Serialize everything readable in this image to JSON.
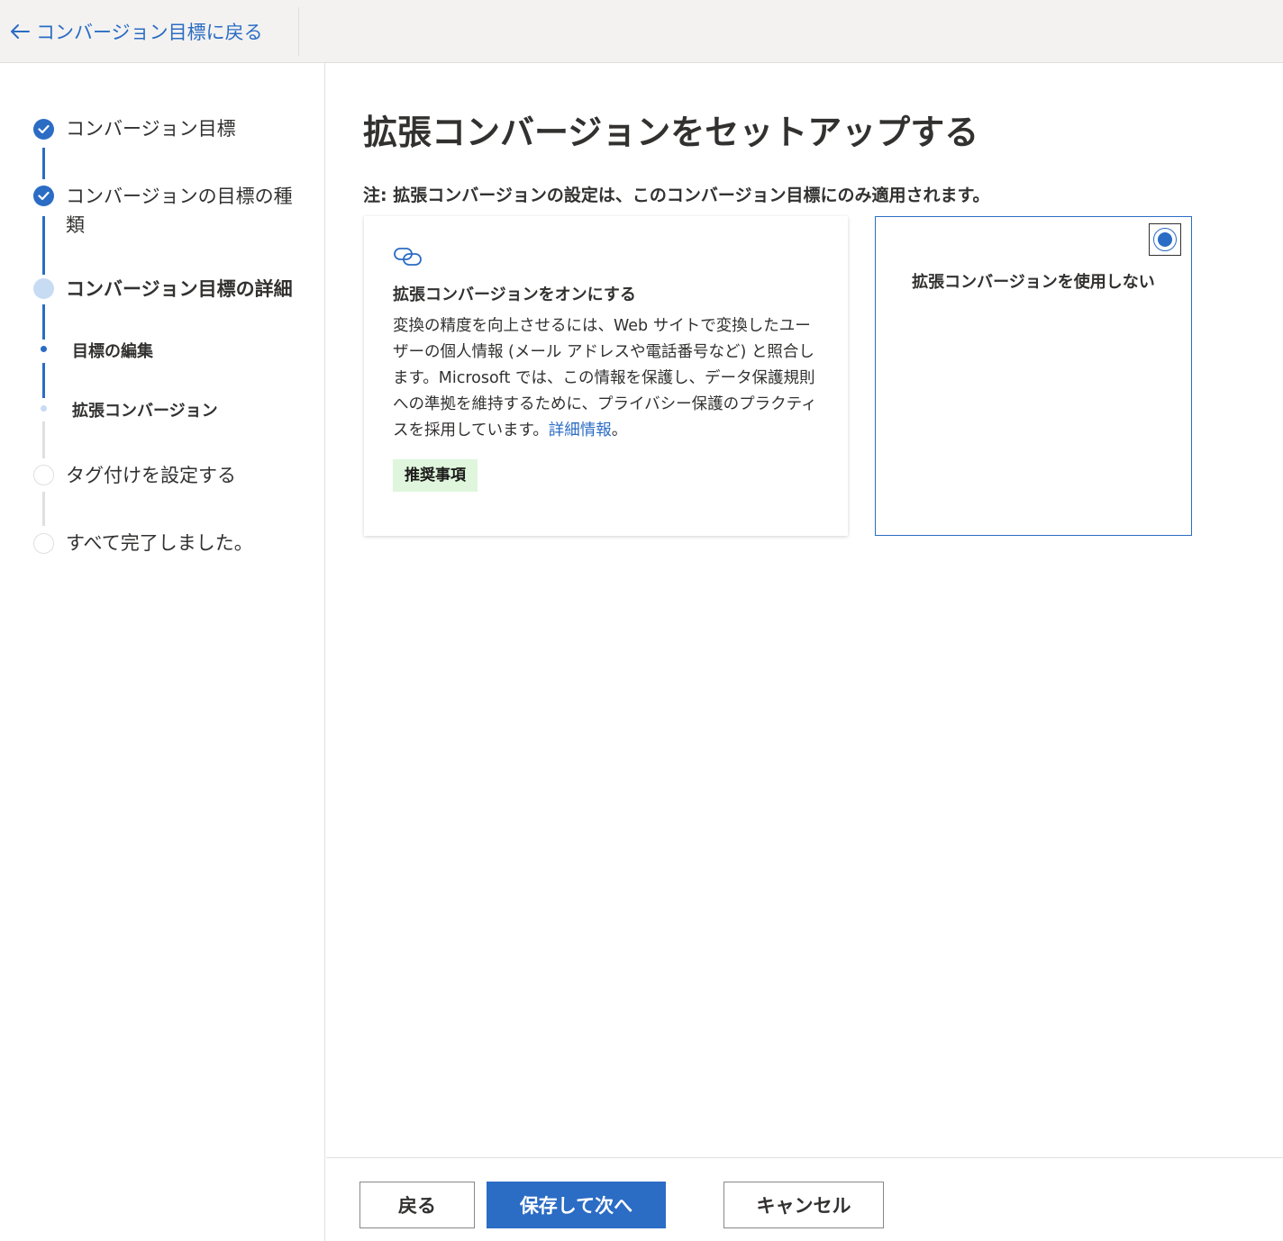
{
  "header": {
    "back_label": "コンバージョン目標に戻る",
    "back_icon": "arrow-left-icon"
  },
  "sidebar": {
    "steps": [
      {
        "label": "コンバージョン目標",
        "status": "done"
      },
      {
        "label": "コンバージョンの目標の種類",
        "status": "done"
      },
      {
        "label": "コンバージョン目標の詳細",
        "status": "current"
      },
      {
        "label": "タグ付けを設定する",
        "status": "todo"
      },
      {
        "label": "すべて完了しました。",
        "status": "todo"
      }
    ],
    "substeps": [
      {
        "label": "目標の編集",
        "status": "active"
      },
      {
        "label": "拡張コンバージョン",
        "status": "current"
      }
    ]
  },
  "main": {
    "title": "拡張コンバージョンをセットアップする",
    "note": "注: 拡張コンバージョンの設定は、このコンバージョン目標にのみ適用されます。",
    "option_on": {
      "icon": "link-icon",
      "title": "拡張コンバージョンをオンにする",
      "description": "変換の精度を向上させるには、Web サイトで変換したユーザーの個人情報 (メール アドレスや電話番号など) と照合します。Microsoft では、この情報を保護し、データ保護規則への準拠を維持するために、プライバシー保護のプラクティスを採用しています。",
      "more_link": "詳細情報",
      "end_punct": "。",
      "badge": "推奨事項",
      "selected": false
    },
    "option_off": {
      "title": "拡張コンバージョンを使用しない",
      "selected": true
    }
  },
  "footer": {
    "back_button": "戻る",
    "save_next_button": "保存して次へ",
    "cancel_button": "キャンセル"
  },
  "colors": {
    "accent": "#2b6cc4",
    "badge_bg": "#dff6dd",
    "topbar_bg": "#f3f2f1"
  }
}
